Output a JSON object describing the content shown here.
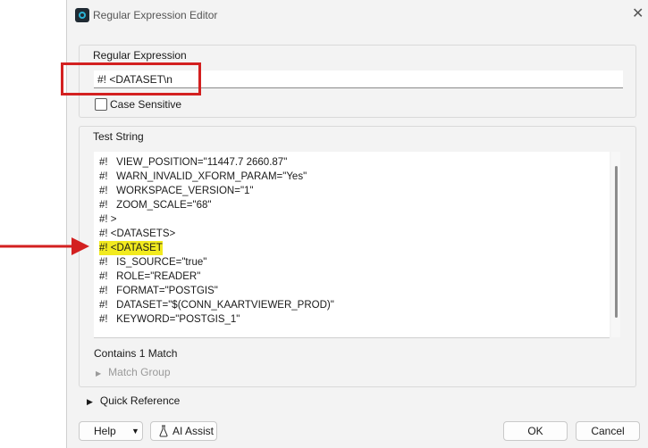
{
  "window": {
    "title": "Regular Expression Editor",
    "close_icon": "close-icon",
    "app_icon": "app-icon"
  },
  "regex": {
    "label": "Regular Expression",
    "value": "#! <DATASET\\n",
    "case_sensitive_label": "Case Sensitive",
    "case_sensitive_checked": false
  },
  "test": {
    "label": "Test String",
    "lines": [
      "#!   VIEW_POSITION=\"11447.7 2660.87\"",
      "#!   WARN_INVALID_XFORM_PARAM=\"Yes\"",
      "#!   WORKSPACE_VERSION=\"1\"",
      "#!   ZOOM_SCALE=\"68\"",
      "#! >",
      "#! <DATASETS>",
      "#! <DATASET",
      "#!   IS_SOURCE=\"true\"",
      "#!   ROLE=\"READER\"",
      "#!   FORMAT=\"POSTGIS\"",
      "#!   DATASET=\"$(CONN_KAARTVIEWER_PROD)\"",
      "#!   KEYWORD=\"POSTGIS_1\""
    ],
    "highlighted_line_index": 6,
    "highlight_color": "#f2ea1f",
    "match_summary": "Contains 1 Match",
    "match_group_label": "Match Group"
  },
  "quick_reference": {
    "label": "Quick Reference"
  },
  "buttons": {
    "help": "Help",
    "ai_assist": "AI Assist",
    "ok": "OK",
    "cancel": "Cancel"
  },
  "annotation_color": "#d32020"
}
